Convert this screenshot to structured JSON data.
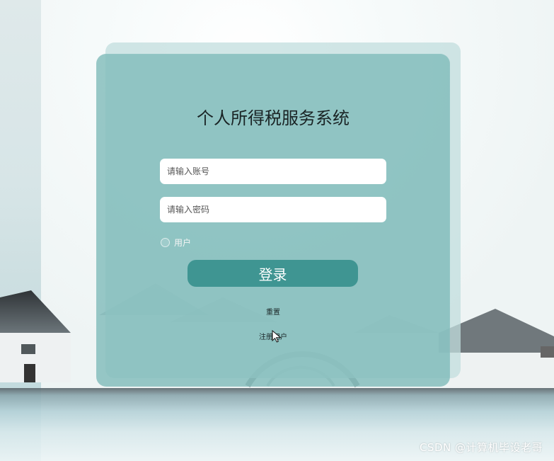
{
  "app": {
    "title": "个人所得税服务系统"
  },
  "login_form": {
    "account_placeholder": "请输入账号",
    "password_placeholder": "请输入密码",
    "role_label": "用户",
    "login_button": "登录",
    "reset_link": "重置",
    "register_link": "注册用户"
  },
  "watermark": "CSDN @计算机毕设老哥",
  "icons": {
    "role_radio": "radio-icon",
    "cursor": "cursor-icon"
  },
  "colors": {
    "panel": "#81bcbb",
    "button": "#3f9592"
  }
}
